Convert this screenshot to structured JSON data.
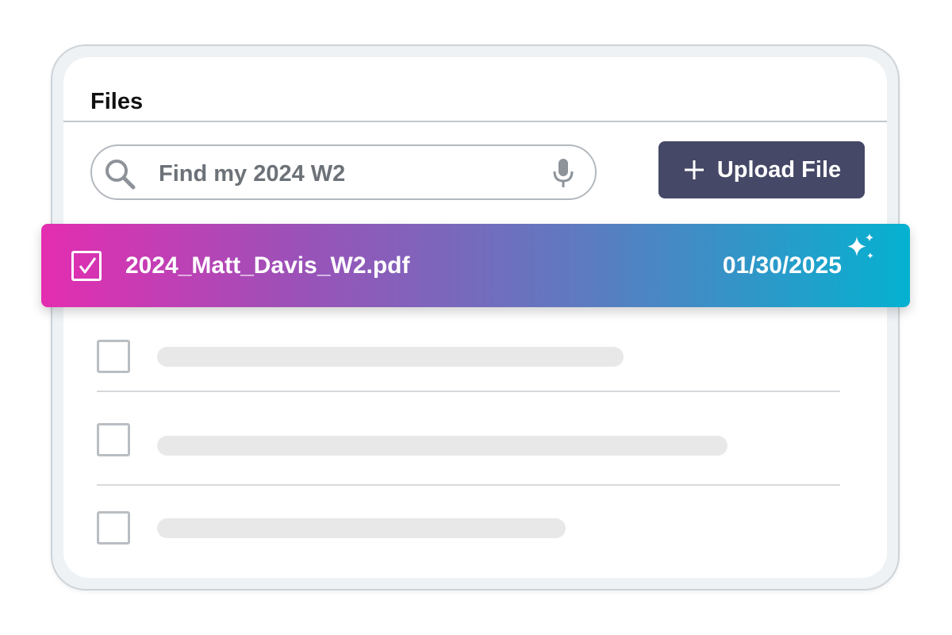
{
  "panel": {
    "title": "Files"
  },
  "search": {
    "value": "Find my 2024 W2",
    "icon": "search-icon",
    "mic_icon": "microphone-icon"
  },
  "toolbar": {
    "upload_label": "Upload File",
    "upload_icon": "plus-icon"
  },
  "files": {
    "selected": {
      "name": "2024_Matt_Davis_W2.pdf",
      "date": "01/30/2025",
      "checked": true,
      "badge_icon": "sparkle-icon"
    },
    "placeholder_rows": 3
  },
  "colors": {
    "button_bg": "#454866",
    "gradient_start": "#e42db0",
    "gradient_mid": "#9a52b8",
    "gradient_end": "#05b1d0",
    "placeholder": "#e8e8e8"
  }
}
